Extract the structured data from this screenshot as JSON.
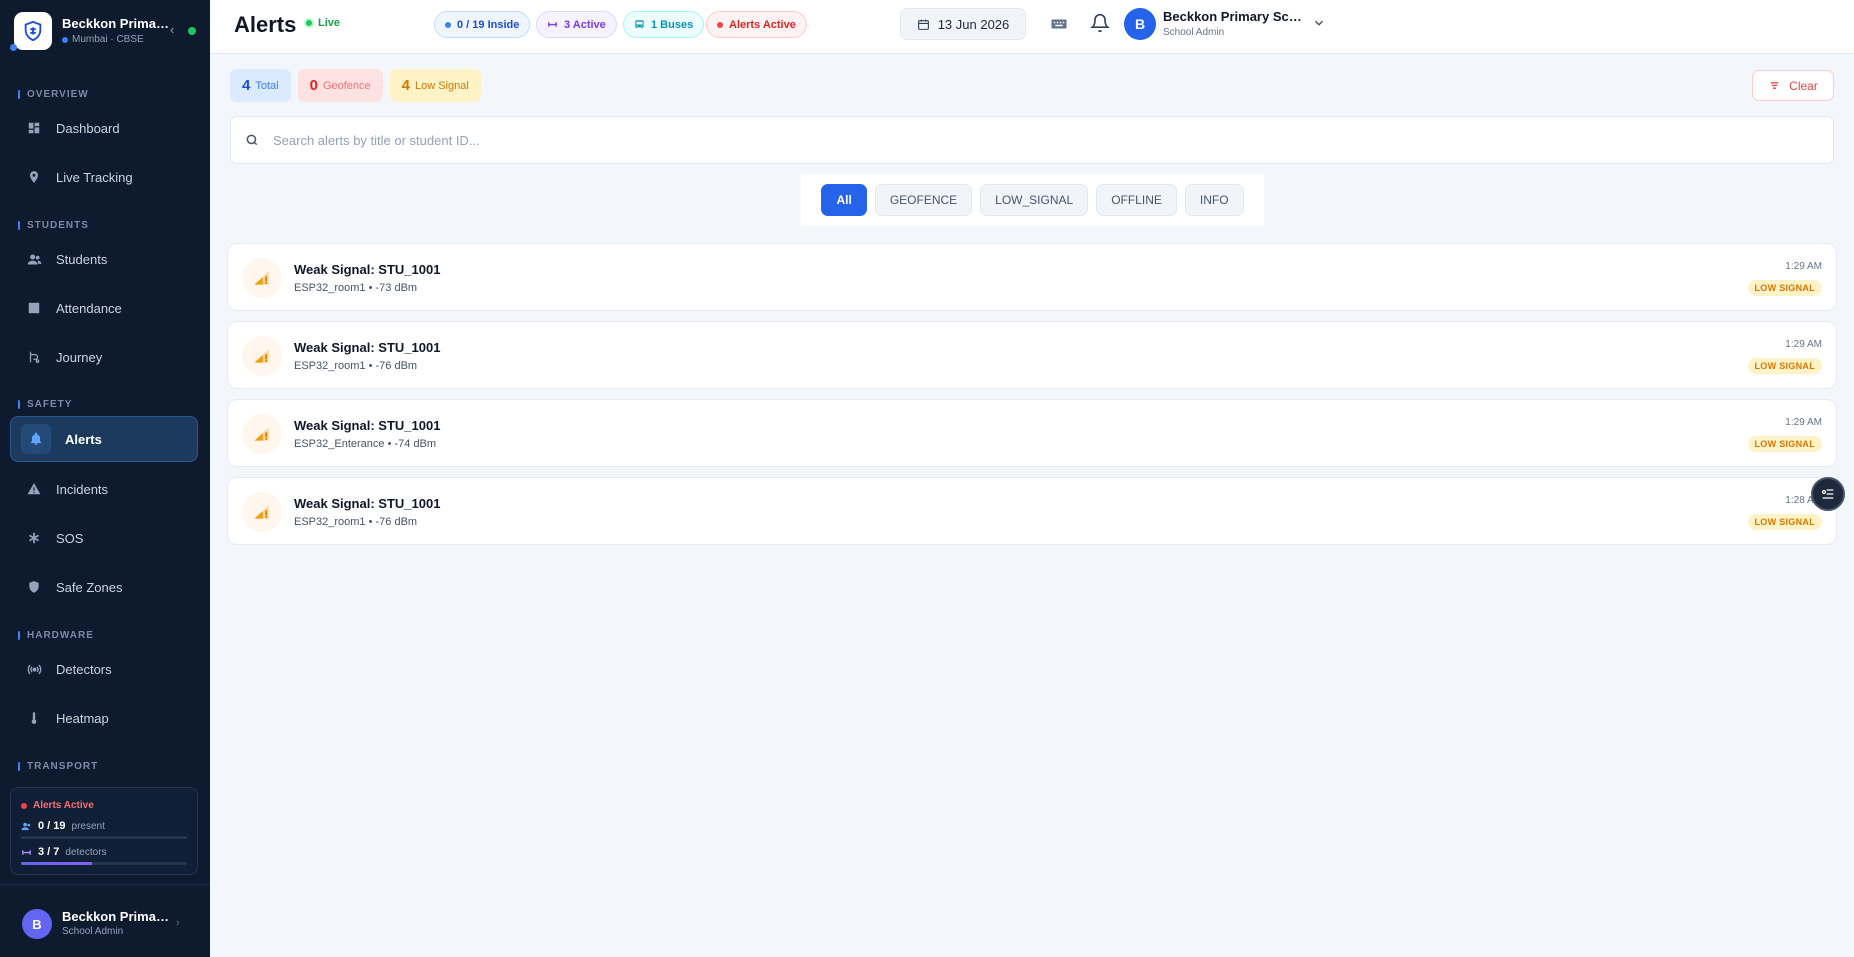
{
  "sidebar": {
    "brand_title": "Beckkon Primary School",
    "brand_sub": "Mumbai · CBSE",
    "sections": {
      "overview": "OVERVIEW",
      "students": "STUDENTS",
      "safety": "SAFETY",
      "hardware": "HARDWARE",
      "transport": "TRANSPORT"
    },
    "items": {
      "dashboard": "Dashboard",
      "live_tracking": "Live Tracking",
      "students": "Students",
      "attendance": "Attendance",
      "journey": "Journey",
      "alerts": "Alerts",
      "incidents": "Incidents",
      "sos": "SOS",
      "safe_zones": "Safe Zones",
      "detectors": "Detectors",
      "heatmap": "Heatmap"
    },
    "status": {
      "alert_label": "Alerts Active",
      "present_value": "0 / 19",
      "present_label": "present",
      "present_fraction": 0,
      "detectors_value": "3 / 7",
      "detectors_label": "detectors",
      "detectors_fraction": 0.43
    },
    "footer": {
      "avatar": "B",
      "name": "Beckkon Primary School",
      "role": "School Admin"
    }
  },
  "header": {
    "title": "Alerts",
    "live": "Live",
    "pills": {
      "inside": "0 / 19 Inside",
      "active": "3 Active",
      "buses": "1 Buses",
      "alerts": "Alerts Active"
    },
    "date": "13 Jun 2026",
    "user_avatar": "B",
    "user_name": "Beckkon Primary School",
    "user_role": "School Admin"
  },
  "stats": {
    "total_count": "4",
    "total_label": "Total",
    "geofence_count": "0",
    "geofence_label": "Geofence",
    "low_count": "4",
    "low_label": "Low Signal"
  },
  "clear_label": "Clear",
  "search": {
    "placeholder": "Search alerts by title or student ID...",
    "value": ""
  },
  "filters": [
    "All",
    "GEOFENCE",
    "LOW_SIGNAL",
    "OFFLINE",
    "INFO"
  ],
  "alerts": [
    {
      "title": "Weak Signal: STU_1001",
      "detector": "ESP32_room1",
      "signal": "-73 dBm",
      "time": "1:29 AM",
      "badge": "LOW SIGNAL"
    },
    {
      "title": "Weak Signal: STU_1001",
      "detector": "ESP32_room1",
      "signal": "-76 dBm",
      "time": "1:29 AM",
      "badge": "LOW SIGNAL"
    },
    {
      "title": "Weak Signal: STU_1001",
      "detector": "ESP32_Enterance",
      "signal": "-74 dBm",
      "time": "1:29 AM",
      "badge": "LOW SIGNAL"
    },
    {
      "title": "Weak Signal: STU_1001",
      "detector": "ESP32_room1",
      "signal": "-76 dBm",
      "time": "1:28 AM",
      "badge": "LOW SIGNAL"
    }
  ]
}
